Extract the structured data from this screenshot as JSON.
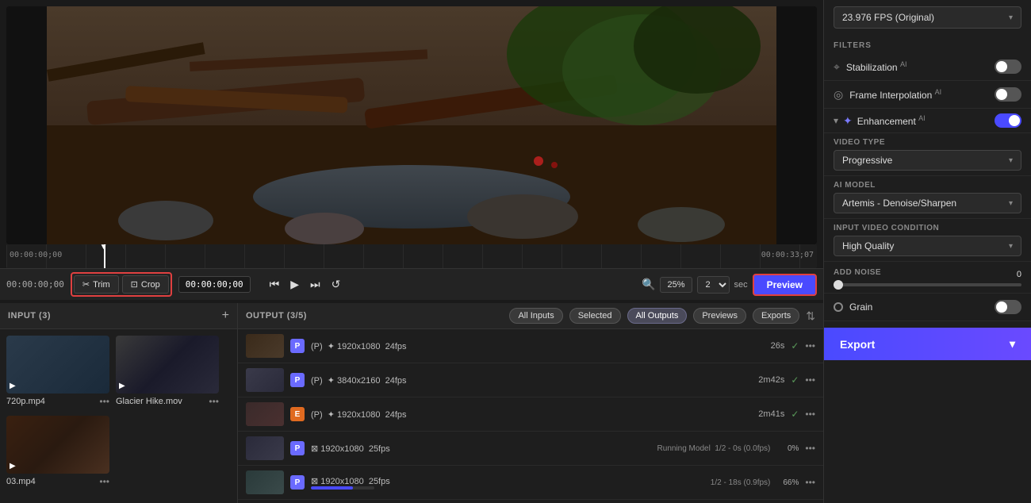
{
  "header": {
    "fps_label": "23.976 FPS (Original)"
  },
  "filters": {
    "section_label": "FILTERS",
    "stabilization": {
      "label": "Stabilization",
      "ai": true,
      "enabled": false
    },
    "frame_interpolation": {
      "label": "Frame Interpolation",
      "ai": true,
      "enabled": false
    },
    "enhancement": {
      "label": "Enhancement",
      "ai": true,
      "enabled": true
    }
  },
  "video_type": {
    "label": "VIDEO TYPE",
    "value": "Progressive"
  },
  "ai_model": {
    "label": "AI MODEL",
    "value": "Artemis - Denoise/Sharpen"
  },
  "input_video_condition": {
    "label": "INPUT VIDEO CONDITION",
    "value": "High Quality"
  },
  "add_noise": {
    "label": "ADD NOISE",
    "value": "0",
    "slider_pos": 0
  },
  "grain": {
    "label": "Grain",
    "enabled": false
  },
  "export": {
    "label": "Export"
  },
  "toolbar": {
    "trim_label": "Trim",
    "crop_label": "Crop",
    "time_display": "00:00:00;00",
    "preview_label": "Preview",
    "zoom_level": "25%",
    "speed_value": "2",
    "sec_label": "sec"
  },
  "timeline": {
    "time_start": "00:00:00;00",
    "time_end": "00:00:33;07",
    "playhead": "00:00:00;00"
  },
  "input_panel": {
    "title": "INPUT (3)",
    "items": [
      {
        "filename": "720p.mp4",
        "thumb_class": "thumb-bg-720"
      },
      {
        "filename": "Glacier Hike.mov",
        "thumb_class": "thumb-bg-glacier"
      },
      {
        "filename": "03.mp4",
        "thumb_class": "thumb-bg-03"
      }
    ]
  },
  "output_panel": {
    "title": "OUTPUT (3/5)",
    "filters": [
      "All Inputs",
      "Selected",
      "All Outputs",
      "Previews",
      "Exports"
    ],
    "active_filter": "All Outputs",
    "rows": [
      {
        "badge": "P",
        "badge_type": "p",
        "info": "(P)  1920x1080  24fps",
        "duration": "26s",
        "has_check": true,
        "thumb_class": "o-thumb-1",
        "status": "done"
      },
      {
        "badge": "P",
        "badge_type": "p",
        "info": "(P)  3840x2160  24fps",
        "duration": "2m42s",
        "has_check": true,
        "thumb_class": "o-thumb-2",
        "status": "done"
      },
      {
        "badge": "E",
        "badge_type": "e",
        "info": "(P)  1920x1080  24fps",
        "duration": "2m41s",
        "has_check": true,
        "thumb_class": "o-thumb-3",
        "status": "done"
      },
      {
        "badge": "P",
        "badge_type": "p",
        "info": "1920x1080  25fps",
        "status_text": "Running Model  1/2 - 0s (0.0fps)",
        "pct": "0%",
        "thumb_class": "o-thumb-4",
        "status": "running",
        "progress": 0
      },
      {
        "badge": "P",
        "badge_type": "p",
        "info": "1920x1080  25fps",
        "status_text": "1/2 - 18s (0.9fps)",
        "pct": "66%",
        "thumb_class": "o-thumb-5",
        "status": "running",
        "progress": 66
      }
    ]
  }
}
